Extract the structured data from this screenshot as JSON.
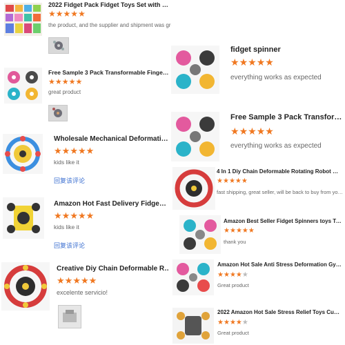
{
  "colors": {
    "star": "#f07821",
    "star_empty": "#bbbbbb",
    "reply_link": "#3b6fd0"
  },
  "reviews": [
    {
      "title": "2022 Fidget Pack Fidget Toys Set with Popping...",
      "review": "the product, and the supplier and shipment was great! fast order and shipping",
      "rating": 5
    },
    {
      "title": "Free Sample 3 Pack Transformable Fingertip Fi...",
      "review": "great product",
      "rating": 5
    },
    {
      "title": "Wholesale Mechanical Deformative Ro",
      "review": "kids like it",
      "rating": 5,
      "reply": "回复该评论"
    },
    {
      "title": "Amazon Hot Fast Delivery Fidget Sensor",
      "review": "kids like it",
      "rating": 5,
      "reply": "回复该评论"
    },
    {
      "title": "Creative Diy Chain Deformable Rotatin",
      "review": "excelente servicio!",
      "rating": 5
    },
    {
      "title": "fidget spinner",
      "review": "everything works as expected",
      "rating": 5
    },
    {
      "title": "Free Sample 3 Pack Transformable",
      "review": "everything works as expected",
      "rating": 5
    },
    {
      "title": "4 In 1 Diy Chain Deformable Rotating Robot Tra...",
      "review": "fast shipping, great seller, will be back to buy from you again!",
      "rating": 5
    },
    {
      "title": "Amazon Best Seller Fidget Spinners toys Trans...",
      "review": "thank you",
      "rating": 5
    },
    {
      "title": "Amazon Hot Sale Anti Stress Deformation Gyro...",
      "review": "Great product",
      "rating": 4
    },
    {
      "title": "2022 Amazon Hot Sale Stress Relief Toys Cust...",
      "review": "Great product",
      "rating": 4
    }
  ]
}
